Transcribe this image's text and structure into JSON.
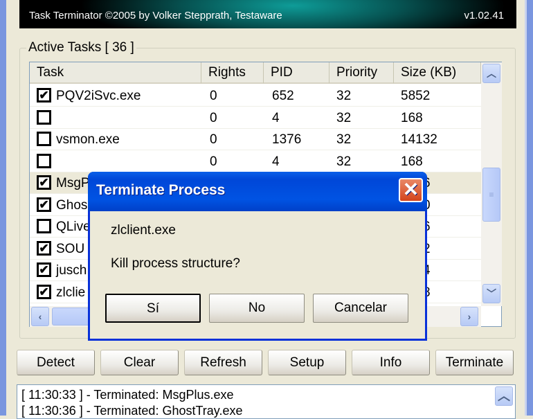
{
  "banner": {
    "credit": "Task Terminator ©2005 by Volker Stepprath, Testaware",
    "version": "v1.02.41"
  },
  "group": {
    "label": "Active Tasks [ 36 ]"
  },
  "columns": [
    "Task",
    "Rights",
    "PID",
    "Priority",
    "Size (KB)"
  ],
  "rows": [
    {
      "checked": true,
      "task": "PQV2iSvc.exe",
      "rights": "0",
      "pid": "652",
      "priority": "32",
      "size": "5852"
    },
    {
      "checked": false,
      "task": "",
      "rights": "0",
      "pid": "4",
      "priority": "32",
      "size": "168"
    },
    {
      "checked": false,
      "task": "vsmon.exe",
      "rights": "0",
      "pid": "1376",
      "priority": "32",
      "size": "14132"
    },
    {
      "checked": false,
      "task": "",
      "rights": "0",
      "pid": "4",
      "priority": "32",
      "size": "168"
    },
    {
      "checked": true,
      "task": "MsgP",
      "size": "6",
      "selected": true
    },
    {
      "checked": true,
      "task": "Ghos",
      "size": "0"
    },
    {
      "checked": false,
      "task": "QLive",
      "size": "6"
    },
    {
      "checked": true,
      "task": "SOU",
      "size": "2"
    },
    {
      "checked": true,
      "task": "jusch",
      "size": "4"
    },
    {
      "checked": true,
      "task": "zlclie",
      "size": "8"
    }
  ],
  "buttons": [
    "Detect",
    "Clear",
    "Refresh",
    "Setup",
    "Info",
    "Terminate"
  ],
  "log": [
    "[ 11:30:33 ] - Terminated: MsgPlus.exe",
    "[ 11:30:36 ] - Terminated: GhostTray.exe"
  ],
  "dialog": {
    "title": "Terminate Process",
    "process": "zlclient.exe",
    "question": "Kill process structure?",
    "yes": "Sí",
    "no": "No",
    "cancel": "Cancelar",
    "close_glyph": "✕"
  },
  "icons": {
    "check": "✔",
    "up": "︿",
    "down": "﹀",
    "left": "‹",
    "right": "›",
    "grip": "≡"
  }
}
